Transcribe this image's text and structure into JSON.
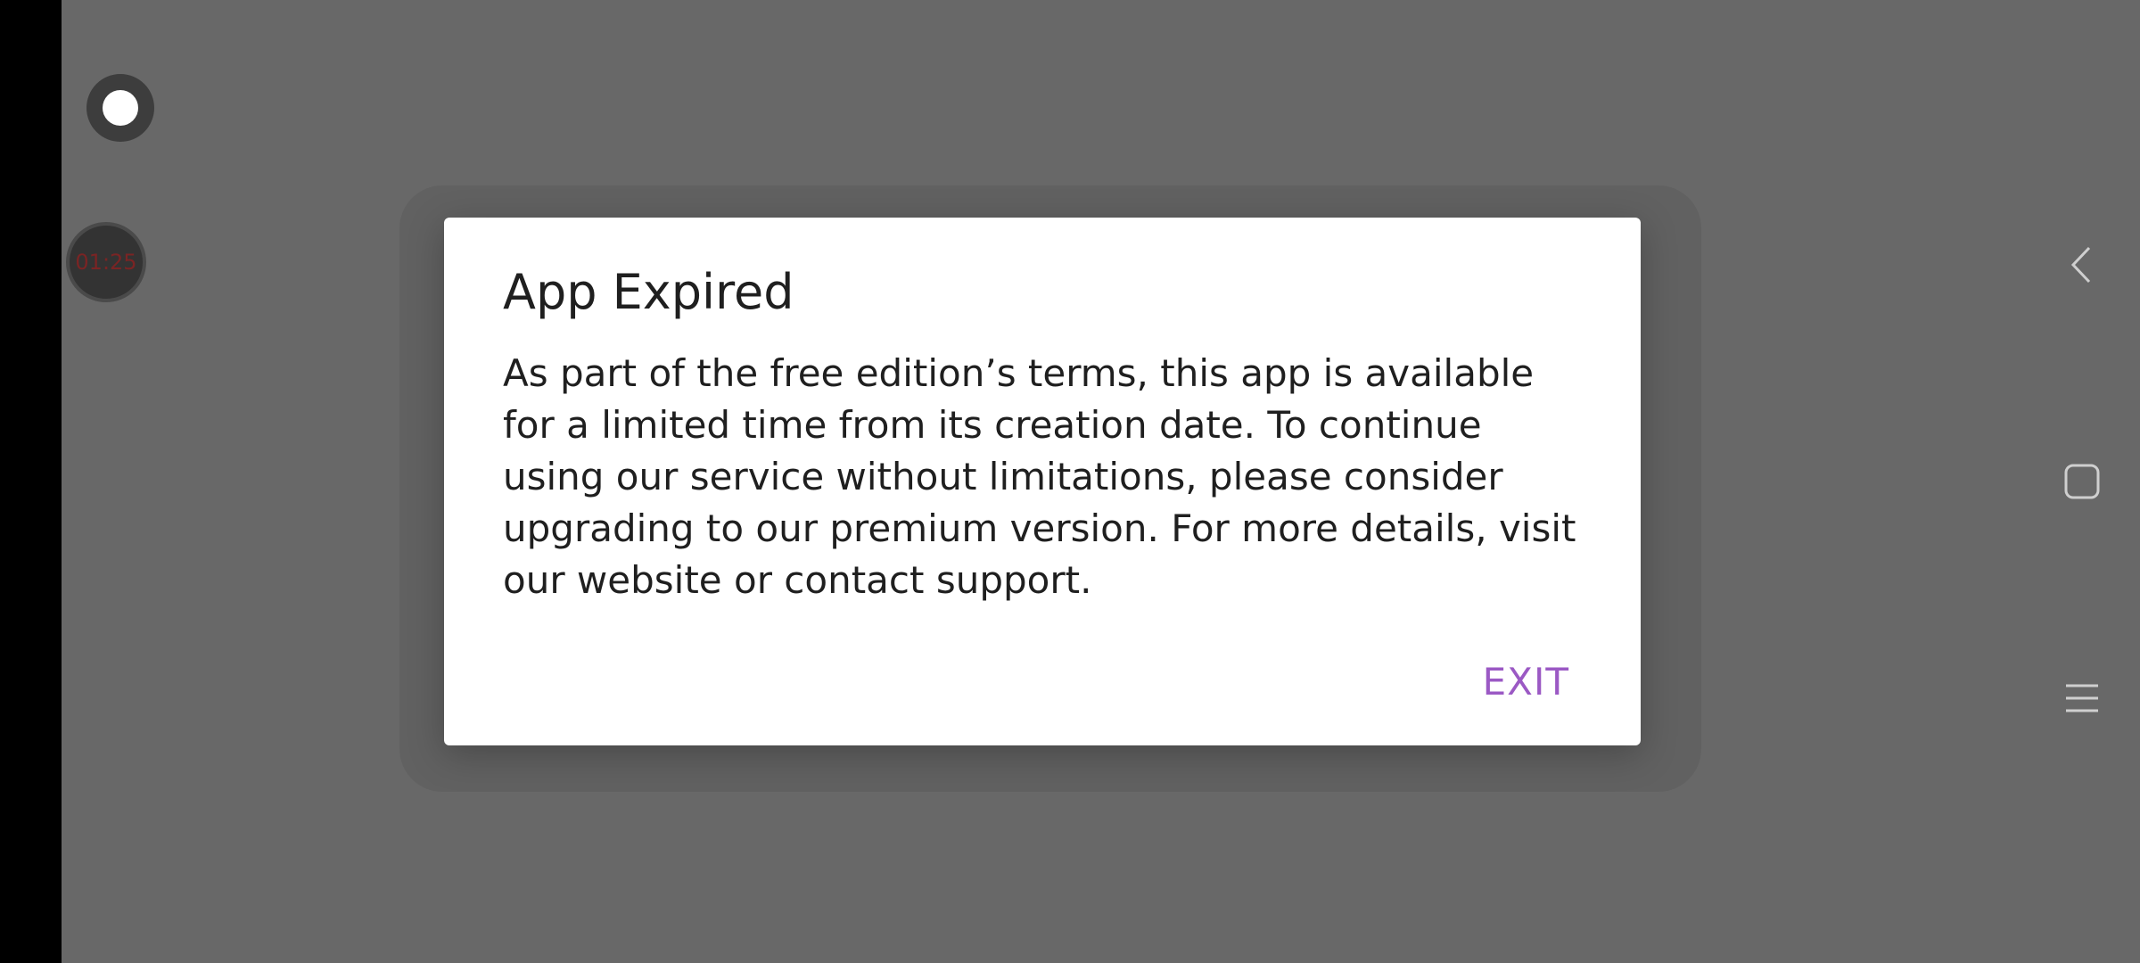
{
  "overlay": {
    "timer_text": "01:25"
  },
  "dialog": {
    "title": "App Expired",
    "message": "As part of the free edition’s terms, this app is available for a limited time from its creation date. To continue using our service without limitations, please consider upgrading to our premium version. For more details, visit our website or contact support.",
    "exit_label": "EXIT",
    "accent_color": "#9b59c4"
  },
  "navigation": {
    "back_icon": "chevron-left-icon",
    "home_icon": "square-icon",
    "recents_icon": "menu-lines-icon"
  },
  "colors": {
    "scrim": "#686868",
    "dialog_bg": "#ffffff",
    "text": "#1f1f1f"
  }
}
